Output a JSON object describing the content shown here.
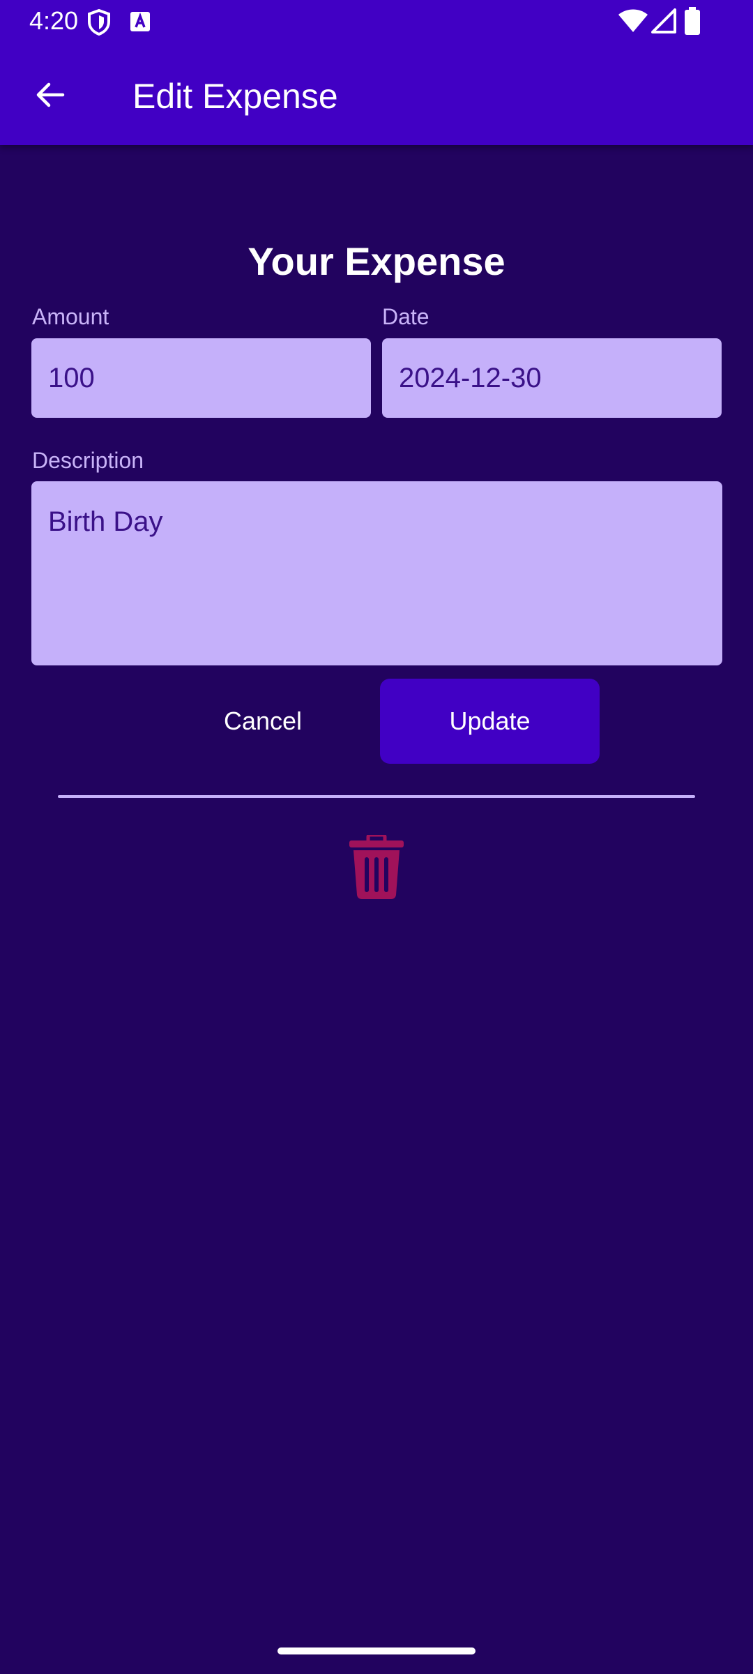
{
  "status_bar": {
    "time": "4:20"
  },
  "app_bar": {
    "title": "Edit Expense",
    "back_icon": "arrow-back-icon"
  },
  "form": {
    "heading": "Your Expense",
    "amount": {
      "label": "Amount",
      "value": "100"
    },
    "date": {
      "label": "Date",
      "value": "2024-12-30"
    },
    "description": {
      "label": "Description",
      "value": "Birth Day"
    }
  },
  "actions": {
    "cancel_label": "Cancel",
    "update_label": "Update",
    "delete_icon": "trash-icon"
  },
  "colors": {
    "background": "#22035f",
    "app_bar": "#4100c4",
    "field_fill": "#c5b0fa",
    "field_text": "#3a1188",
    "label_text": "#c9b4f8",
    "delete_icon": "#a0125a"
  }
}
